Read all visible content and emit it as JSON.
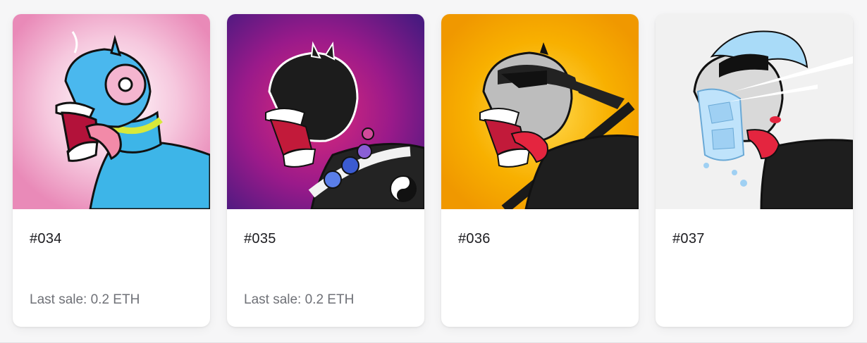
{
  "cards": [
    {
      "id": "#034",
      "last_sale": "Last sale: 0.2 ETH",
      "bg": "#f0a8c8",
      "accent": "#3db5e8"
    },
    {
      "id": "#035",
      "last_sale": "Last sale: 0.2 ETH",
      "bg": "#8a1f86",
      "accent": "#222222"
    },
    {
      "id": "#036",
      "last_sale": "",
      "bg": "#f4a200",
      "accent": "#2a2a2a"
    },
    {
      "id": "#037",
      "last_sale": "",
      "bg": "#f2f2f2",
      "accent": "#9fd4f5"
    }
  ]
}
